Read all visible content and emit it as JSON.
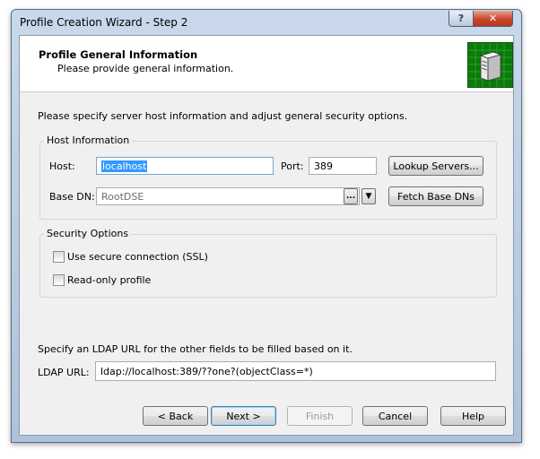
{
  "window": {
    "title": "Profile Creation Wizard - Step 2"
  },
  "titlebar": {
    "help_label": "?",
    "close_label": "✕"
  },
  "header": {
    "title": "Profile General Information",
    "subtitle": "Please provide general information.",
    "icon": "server-icon"
  },
  "instruction": "Please specify server host information and adjust general security options.",
  "host_group": {
    "label": "Host Information",
    "host_label": "Host:",
    "host_value": "localhost",
    "port_label": "Port:",
    "port_value": "389",
    "lookup_label": "Lookup Servers...",
    "basedn_label": "Base DN:",
    "basedn_value": "RootDSE",
    "browse_label": "...",
    "fetch_label": "Fetch Base DNs"
  },
  "security_group": {
    "label": "Security Options",
    "ssl_label": "Use secure connection (SSL)",
    "ssl_checked": false,
    "readonly_label": "Read-only profile",
    "readonly_checked": false
  },
  "ldap": {
    "hint": "Specify an LDAP URL for the other fields to be filled based on it.",
    "label": "LDAP URL:",
    "value": "ldap://localhost:389/??one?(objectClass=*)"
  },
  "buttons": {
    "back": "< Back",
    "next": "Next >",
    "finish": "Finish",
    "cancel": "Cancel",
    "help": "Help"
  }
}
